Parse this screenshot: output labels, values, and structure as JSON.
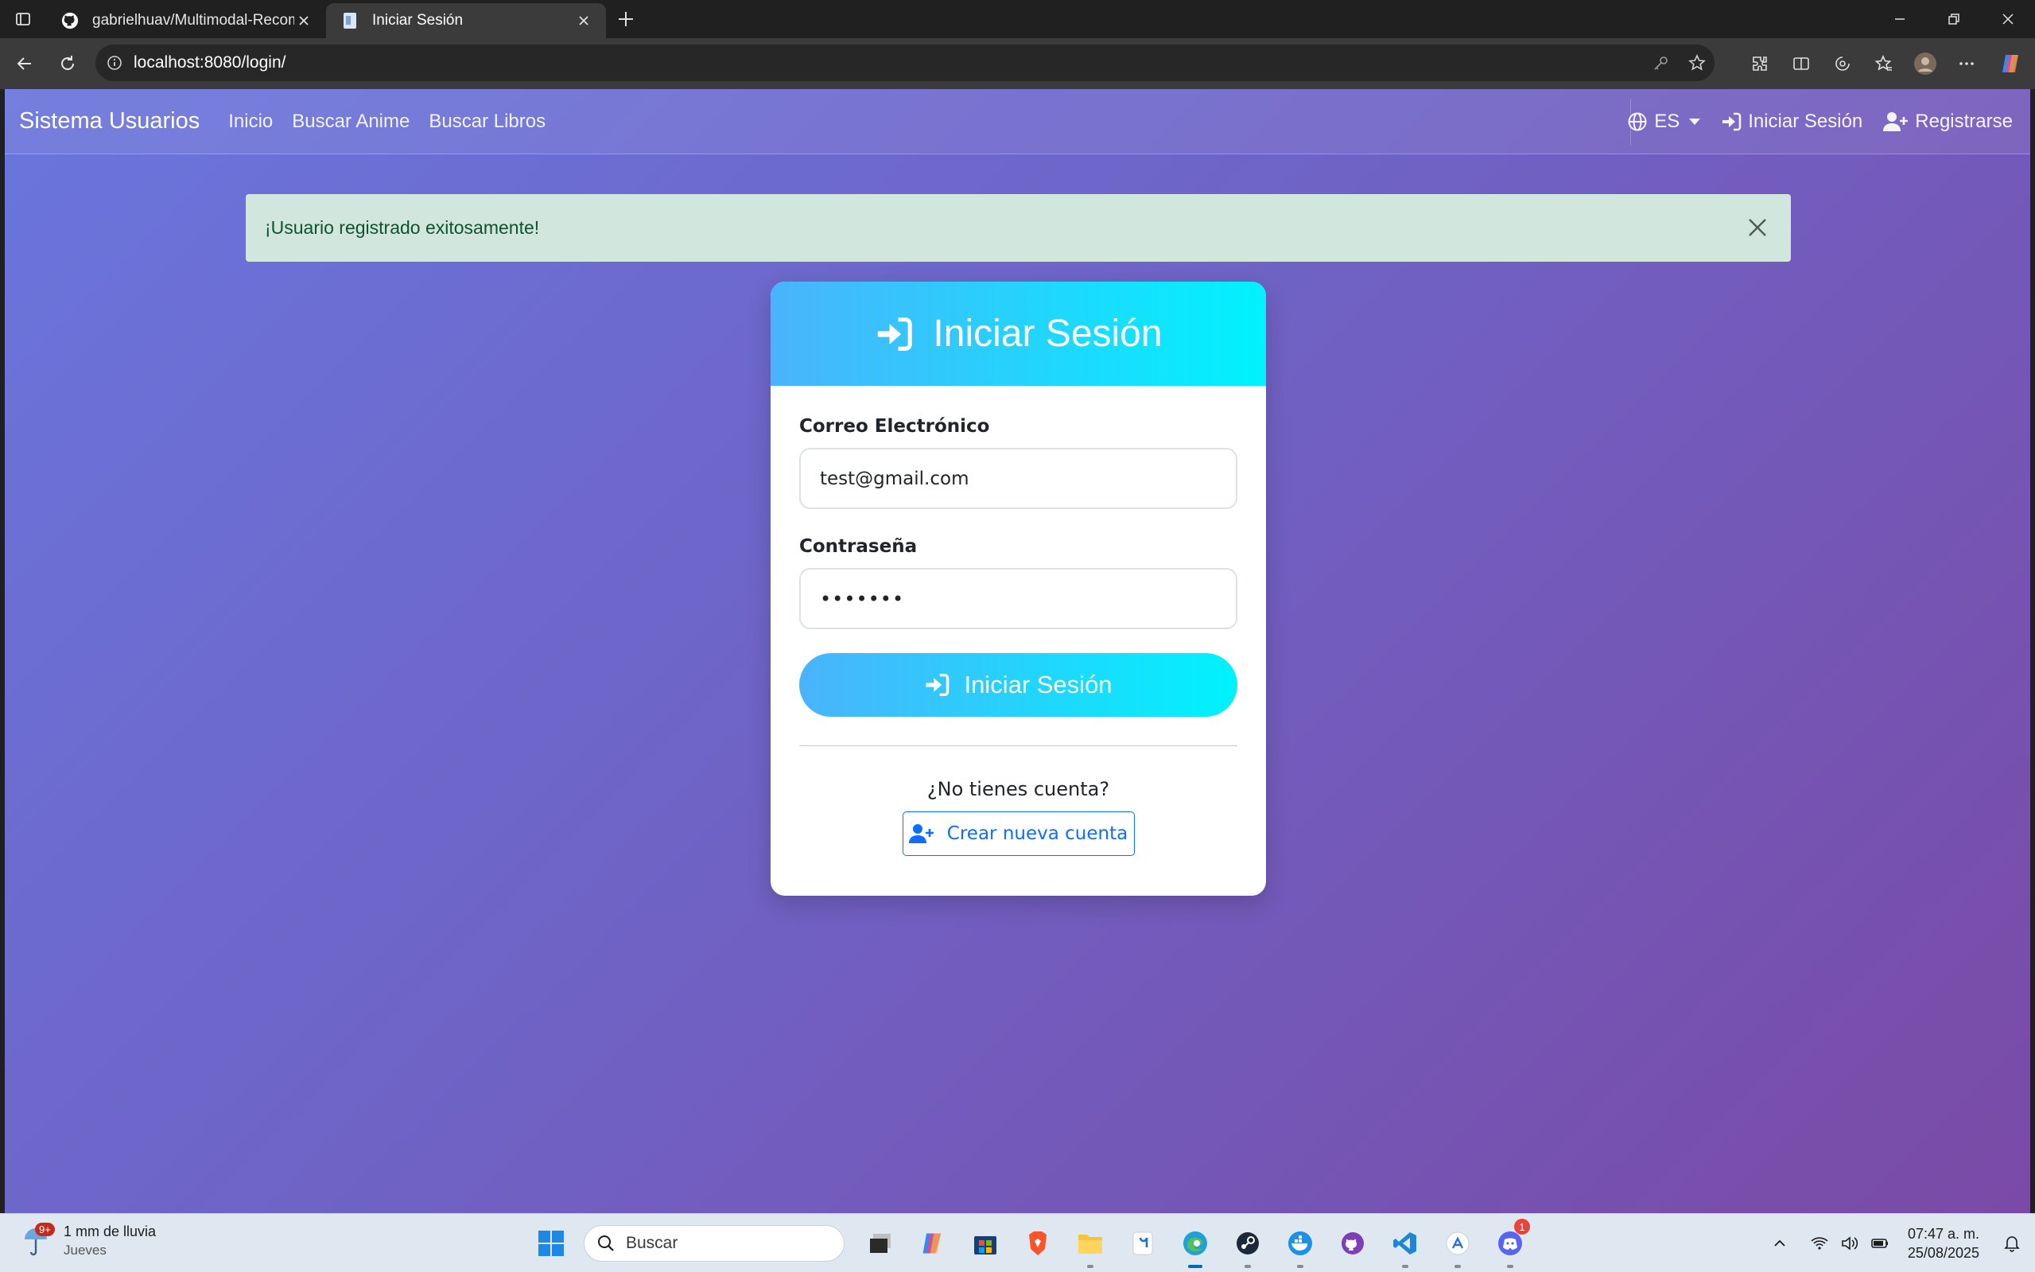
{
  "browser": {
    "tabs": [
      {
        "title": "gabrielhuav/Multimodal-Recomm",
        "active": false
      },
      {
        "title": "Iniciar Sesión",
        "active": true
      }
    ],
    "url": "localhost:8080/login/"
  },
  "navbar": {
    "brand": "Sistema Usuarios",
    "links": [
      "Inicio",
      "Buscar Anime",
      "Buscar Libros"
    ],
    "language": "ES",
    "login_label": "Iniciar Sesión",
    "register_label": "Registrarse"
  },
  "alert": {
    "message": "¡Usuario registrado exitosamente!"
  },
  "login_card": {
    "title": "Iniciar Sesión",
    "email_label": "Correo Electrónico",
    "email_value": "test@gmail.com",
    "password_label": "Contraseña",
    "password_value": "•••••••",
    "submit_label": "Iniciar Sesión",
    "no_account_text": "¿No tienes cuenta?",
    "create_account_label": "Crear nueva cuenta"
  },
  "taskbar": {
    "weather_title": "1 mm de lluvia",
    "weather_day": "Jueves",
    "weather_badge": "9+",
    "search_placeholder": "Buscar",
    "discord_badge": "1",
    "time": "07:47 a. m.",
    "date": "25/08/2025"
  },
  "colors": {
    "page_gradient_start": "#6a75dc",
    "page_gradient_end": "#7a4aa6",
    "card_header_start": "#4ab3fb",
    "card_header_end": "#00f2fe",
    "alert_bg": "#d1e7dd",
    "alert_text": "#0f5132",
    "link_blue": "#0d6efd"
  }
}
